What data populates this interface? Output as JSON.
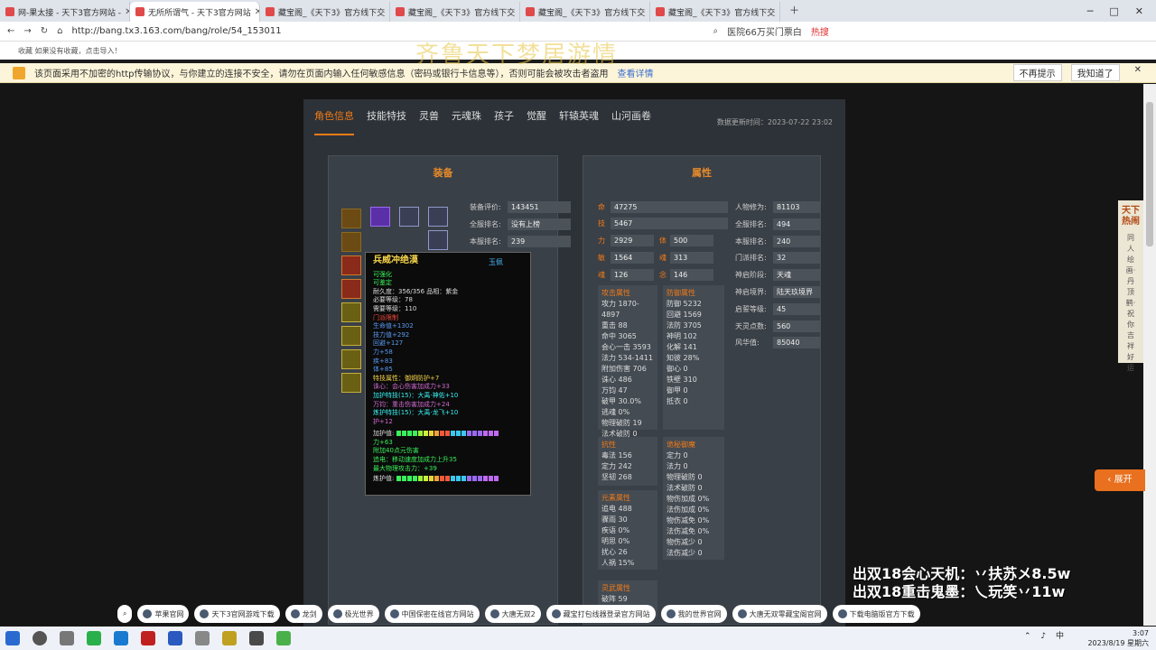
{
  "browser": {
    "tabs": [
      "网-果太接 - 天下3官方网站 -",
      "无所所谓气 - 天下3官方网站",
      "藏宝阁_《天下3》官方线下交",
      "藏宝阁_《天下3》官方线下交",
      "藏宝阁_《天下3》官方线下交",
      "藏宝阁_《天下3》官方线下交"
    ],
    "url": "http://bang.tx3.163.com/bang/role/54_153011",
    "search": "医院66万买门票白",
    "hot": "热搜",
    "bookmark_bar": "收藏  如果没有收藏，点击导入！"
  },
  "warning": {
    "text": "该页面采用不加密的http传输协议，与你建立的连接不安全，请勿在页面内输入任何敏感信息（密码或银行卡信息等），否则可能会被攻击者盗用",
    "link": "查看详情",
    "btn1": "不再提示",
    "btn2": "我知道了"
  },
  "bg_title": "齐鲁天下梦居游情",
  "nav": {
    "tabs": [
      "角色信息",
      "技能特技",
      "灵兽",
      "元魂珠",
      "孩子",
      "觉醒",
      "轩辕英魂",
      "山河画卷"
    ],
    "time": "数据更新时间：2023-07-22 23:02"
  },
  "equip": {
    "title": "装备",
    "stats": [
      {
        "l": "装备评价:",
        "v": "143451"
      },
      {
        "l": "全服排名:",
        "v": "没有上榜"
      },
      {
        "l": "本服排名:",
        "v": "239"
      }
    ]
  },
  "attr": {
    "title": "属性",
    "main": [
      {
        "l": "命",
        "v": "47275"
      },
      {
        "l": "技",
        "v": "5467"
      }
    ],
    "pairs": [
      [
        "力",
        "2929",
        "体",
        "500"
      ],
      [
        "敏",
        "1564",
        "魂",
        "313"
      ],
      [
        "魂",
        "126",
        "念",
        "146"
      ]
    ],
    "right": [
      {
        "l": "人物修为:",
        "v": "81103"
      },
      {
        "l": "全服排名:",
        "v": "494"
      },
      {
        "l": "本服排名:",
        "v": "240"
      },
      {
        "l": "门派排名:",
        "v": "32"
      },
      {
        "l": "神启阶段:",
        "v": "天魂"
      },
      {
        "l": "神启境界:",
        "v": "陆天玖境界"
      },
      {
        "l": "启誓等级:",
        "v": "45"
      },
      {
        "l": "天灵点数:",
        "v": "560"
      },
      {
        "l": "风华值:",
        "v": "85040"
      }
    ],
    "attack": {
      "t": "攻击属性",
      "items": [
        "攻力 1870-4897",
        "重击 88",
        "命中 3065",
        "会心一击 3593",
        "法力 534-1411",
        "附加伤害 706",
        "诛心 486",
        "万钧 47",
        "破甲 30.0%",
        "逃魂 0%",
        "物理破防 19",
        "法术破防 0"
      ]
    },
    "defense": {
      "t": "防御属性",
      "items": [
        "防御 5232",
        "回避 1569",
        "法防 3705",
        "神明 102",
        "化解 141",
        "知彼 28%",
        "御心 0",
        "铁壁 310",
        "御甲 0",
        "抵衣 0"
      ]
    },
    "resist": {
      "t": "抗性",
      "items": [
        "毒法 156",
        "定力 242",
        "坚韧 268"
      ]
    },
    "special": {
      "t": "诡秘御魔",
      "items": [
        "定力 0",
        "法力 0",
        "物理破防 0",
        "法术破防 0",
        "物伤加成 0%",
        "法伤加成 0%",
        "物伤减免 0%",
        "法伤减免 0%",
        "物伤减少 0",
        "法伤减少 0"
      ]
    },
    "element": {
      "t": "元素属性",
      "items": [
        "追电 488",
        "骤雨 30",
        "疾语 0%",
        "明思 0%",
        "扰心 26",
        "人祸 15%"
      ]
    },
    "more": {
      "t": "灵武属性",
      "items": [
        "破阵 59"
      ]
    }
  },
  "tooltip": {
    "name": "兵威冲绝漠",
    "badge": "玉佩",
    "lines": [
      {
        "c": "g1",
        "t": "可强化"
      },
      {
        "c": "g1",
        "t": "可鉴定"
      },
      {
        "c": "",
        "t": "耐久度：356/356      品相：紫金"
      },
      {
        "c": "",
        "t": "必要等级：78"
      },
      {
        "c": "",
        "t": "需要等级：110"
      },
      {
        "c": "r1",
        "t": "门派限制"
      },
      {
        "c": "b1",
        "t": "生命值+1302"
      },
      {
        "c": "b1",
        "t": "技力值+292"
      },
      {
        "c": "b1",
        "t": "回避+127"
      },
      {
        "c": "b1",
        "t": "力+58"
      },
      {
        "c": "b1",
        "t": "疾+83"
      },
      {
        "c": "b1",
        "t": "体+85"
      },
      {
        "c": "y1",
        "t": "特技属性：御炯防护+7"
      },
      {
        "c": "pk",
        "t": "诛心：会心伤害加成力+33"
      },
      {
        "c": "c1",
        "t": "加护特技(15)：大禹·神佑+10"
      },
      {
        "c": "pk",
        "t": "万钧：重击伤害加成力+24"
      },
      {
        "c": "c1",
        "t": "炼护特技(15)：大禹·龙飞+10"
      },
      {
        "c": "pk",
        "t": "护+12"
      }
    ],
    "enh1": "加护值:",
    "enh_lines": [
      {
        "c": "g1",
        "t": "力+63"
      },
      {
        "c": "g1",
        "t": "附加40点元伤害"
      },
      {
        "c": "g1",
        "t": "追电：移动速度加成力上升35"
      },
      {
        "c": "g1",
        "t": "最大物理攻击力：+39"
      }
    ],
    "enh2": "炼护值:"
  },
  "side": {
    "hot": "天下热闹",
    "vert": "同人绘画·丹顶鹤·祝你吉祥好运",
    "expand": "展开"
  },
  "overlay": [
    "出双18会心天机：丷扶苏メ8.5w",
    "出双18重击鬼墨：乀玩笑丷11w"
  ],
  "quick": [
    "苹果官网",
    "天下3官网游戏下载",
    "龙剑",
    "极光世界",
    "中国保密在线官方网站",
    "大唐无双2",
    "藏宝打包线器登录官方网站",
    "我的世界官网",
    "大唐无双零藏宝阁官网",
    "下载电脑版官方下载"
  ],
  "tray": {
    "time": "3:07",
    "date": "2023/8/19 星期六",
    "ime": "中"
  }
}
